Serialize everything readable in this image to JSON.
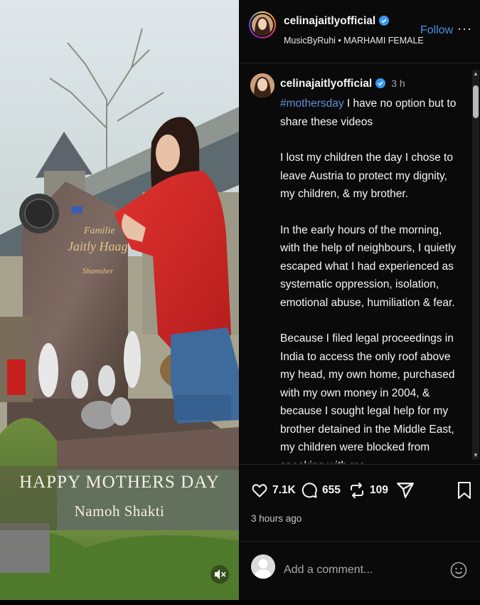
{
  "media": {
    "caption_line1": "HAPPY MOTHERS DAY",
    "caption_line2": "Namoh Shakti",
    "mute_icon": "speaker-muted-icon"
  },
  "header": {
    "username": "celinajaitlyofficial",
    "audio_line": "MusicByRuhi • MARHAMI FEMALE",
    "follow_label": "Follow",
    "more_label": "···"
  },
  "caption": {
    "username": "celinajaitlyofficial",
    "time": "3 h",
    "hashtag": "#mothersday",
    "line0_rest": " I have no option but to share these videos",
    "paragraph1": "I lost my children the day I chose to leave Austria to protect my dignity, my children, & my brother.",
    "paragraph2": "In the early hours of the morning, with the help of neighbours, I quietly escaped what I had experienced as systematic oppression, isolation, emotional abuse, humiliation & fear.",
    "paragraph3": "Because I filed legal proceedings in India to access the only roof above my head, my own home, purchased with my own money in 2004, & because I sought legal help for my brother detained in the Middle East, my children were blocked from speaking with me"
  },
  "actions": {
    "likes": "7.1K",
    "comments": "655",
    "reposts": "109",
    "posted": "3 hours ago"
  },
  "add_comment": {
    "placeholder": "Add a comment..."
  },
  "colors": {
    "accent": "#4a90e2",
    "hashtag": "#5b8fd8",
    "verified": "#3897f0",
    "jacket": "#d42a2a",
    "panel_bg": "#0a0a0a"
  }
}
